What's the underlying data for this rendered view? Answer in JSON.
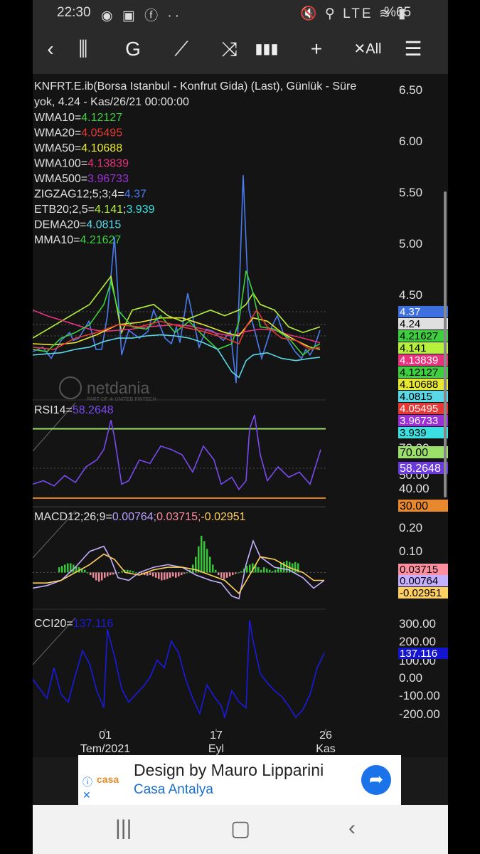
{
  "status": {
    "time": "22:30",
    "left_icons": "◉ ▣ ⓕ ··",
    "right_icons": "🔇 ⚲ LTE ≋ ▮",
    "battery": "%65"
  },
  "toolbar": [
    {
      "name": "back-icon",
      "glyph": "‹"
    },
    {
      "name": "candlestick-icon",
      "glyph": "⫼"
    },
    {
      "name": "g-label",
      "glyph": "G"
    },
    {
      "name": "trendline-icon",
      "glyph": "⟋"
    },
    {
      "name": "indicator-icon",
      "glyph": "⤨"
    },
    {
      "name": "bar-chart-icon",
      "glyph": "▮▮▮"
    },
    {
      "name": "crosshair-icon",
      "glyph": "+"
    },
    {
      "name": "clear-all-icon",
      "glyph": "✕All"
    },
    {
      "name": "menu-icon",
      "glyph": "☰"
    }
  ],
  "chart_header": {
    "line1": "KNFRT.E.ib(Borsa Istanbul - Konfrut Gida) (Last),  Günlük - Süre",
    "line2": "yok, 4.24 - Kas/26/21 00:00:00"
  },
  "chart_data": [
    {
      "type": "line",
      "title": "",
      "ylim": [
        3.75,
        6.65
      ],
      "y_ticks": [
        "6.50",
        "6.00",
        "5.50",
        "5.00",
        "4.50"
      ],
      "legend": [
        {
          "label": "WMA10=",
          "value": "4.12127",
          "color": "#3ecf3e"
        },
        {
          "label": "WMA20=",
          "value": "4.05495",
          "color": "#e53935"
        },
        {
          "label": "WMA50=",
          "value": "4.10688",
          "color": "#e8e830"
        },
        {
          "label": "WMA100=",
          "value": "4.13839",
          "color": "#e8327e"
        },
        {
          "label": "WMA500=",
          "value": "3.96733",
          "color": "#9b30d9"
        },
        {
          "label": "ZIGZAG12;5;3;4=",
          "value": "4.37",
          "color": "#4a7bf0"
        },
        {
          "label": "ETB20;2,5=",
          "value": "4.141",
          "value2": "3.939",
          "color": "#b6f03c",
          "color2": "#3ce0e0"
        },
        {
          "label": "DEMA20=",
          "value": "4.0815",
          "color": "#5ad8e8"
        },
        {
          "label": "MMA10=",
          "value": "4.21627",
          "color": "#3ecf3e"
        }
      ],
      "value_tags": [
        {
          "text": "4.37",
          "bg": "#3d6fe0",
          "fg": "#ffffff"
        },
        {
          "text": "4.24",
          "bg": "#e0e0e0",
          "fg": "#000000"
        },
        {
          "text": "4.21627",
          "bg": "#3ecf3e",
          "fg": "#000000"
        },
        {
          "text": "4.141",
          "bg": "#b6f03c",
          "fg": "#000000"
        },
        {
          "text": "4.13839",
          "bg": "#e8327e",
          "fg": "#ffffff"
        },
        {
          "text": "4.12127",
          "bg": "#3ecf3e",
          "fg": "#000000"
        },
        {
          "text": "4.10688",
          "bg": "#e8e830",
          "fg": "#000000"
        },
        {
          "text": "4.0815",
          "bg": "#5ad8e8",
          "fg": "#000000"
        },
        {
          "text": "4.05495",
          "bg": "#e53935",
          "fg": "#ffffff"
        },
        {
          "text": "3.96733",
          "bg": "#9b30d9",
          "fg": "#ffffff"
        },
        {
          "text": "3.939",
          "bg": "#3ce0e0",
          "fg": "#000000"
        }
      ],
      "series": [
        {
          "color": "#4a7bf0",
          "x": [
            0,
            14,
            26,
            40,
            52,
            57,
            65,
            79,
            89,
            97,
            105,
            115,
            125,
            135,
            150,
            162,
            170,
            186,
            195,
            202,
            207,
            218,
            234,
            244,
            254,
            268,
            278,
            286,
            296,
            304,
            312,
            322,
            336,
            344,
            352,
            362,
            369,
            378,
            384,
            390,
            396,
            404
          ],
          "values": [
            4.18,
            4.22,
            4.12,
            4.28,
            4.35,
            4.28,
            4.3,
            4.45,
            4.2,
            4.2,
            4.5,
            5.2,
            4.15,
            4.37,
            4.3,
            4.36,
            4.55,
            4.3,
            4.25,
            4.4,
            4.26,
            4.7,
            4.22,
            4.38,
            4.36,
            4.28,
            4.36,
            3.9,
            5.75,
            4.55,
            4.37,
            4.12,
            4.4,
            4.5,
            4.35,
            4.25,
            4.18,
            4.12,
            4.2,
            4.15,
            4.22,
            4.37
          ]
        },
        {
          "color": "#b6f03c",
          "x": [
            0,
            40,
            80,
            110,
            125,
            140,
            170,
            190,
            210,
            230,
            250,
            270,
            290,
            300,
            310,
            320,
            340,
            360,
            380,
            404
          ],
          "values": [
            4.3,
            4.45,
            4.6,
            4.85,
            4.35,
            4.55,
            4.6,
            4.5,
            4.45,
            4.5,
            4.55,
            4.5,
            4.55,
            4.6,
            4.7,
            4.6,
            4.55,
            4.4,
            4.35,
            4.4
          ]
        },
        {
          "color": "#e8327e",
          "x": [
            0,
            20,
            40,
            60,
            80,
            100,
            120,
            140,
            160,
            180,
            200,
            220,
            240,
            260,
            280,
            300,
            320,
            340,
            360,
            380,
            404
          ],
          "values": [
            4.55,
            4.5,
            4.46,
            4.42,
            4.38,
            4.36,
            4.37,
            4.38,
            4.4,
            4.41,
            4.42,
            4.41,
            4.38,
            4.34,
            4.32,
            4.36,
            4.38,
            4.37,
            4.33,
            4.3,
            4.26
          ]
        },
        {
          "color": "#e8e830",
          "x": [
            0,
            30,
            60,
            90,
            120,
            150,
            180,
            210,
            240,
            270,
            290,
            300,
            310,
            330,
            350,
            370,
            390,
            404
          ],
          "values": [
            4.25,
            4.24,
            4.26,
            4.33,
            4.42,
            4.44,
            4.48,
            4.48,
            4.42,
            4.35,
            4.32,
            4.4,
            4.48,
            4.45,
            4.35,
            4.28,
            4.22,
            4.2
          ]
        },
        {
          "color": "#3ecf3e",
          "x": [
            0,
            20,
            40,
            60,
            80,
            100,
            110,
            120,
            140,
            160,
            180,
            200,
            220,
            240,
            260,
            280,
            290,
            300,
            310,
            320,
            340,
            360,
            380,
            390,
            404
          ],
          "values": [
            4.2,
            4.18,
            4.3,
            4.35,
            4.42,
            4.6,
            4.8,
            4.55,
            4.4,
            4.38,
            4.5,
            4.35,
            4.45,
            4.32,
            4.2,
            4.25,
            4.45,
            4.9,
            4.7,
            4.4,
            4.38,
            4.3,
            4.15,
            4.2,
            4.25
          ]
        },
        {
          "color": "#e53935",
          "x": [
            0,
            30,
            60,
            90,
            120,
            150,
            180,
            210,
            240,
            270,
            290,
            300,
            315,
            330,
            350,
            370,
            390,
            404
          ],
          "values": [
            4.22,
            4.2,
            4.3,
            4.35,
            4.42,
            4.4,
            4.45,
            4.4,
            4.36,
            4.3,
            4.25,
            4.4,
            4.55,
            4.4,
            4.3,
            4.28,
            4.2,
            4.22
          ]
        },
        {
          "color": "#5ad8e8",
          "x": [
            0,
            20,
            40,
            60,
            80,
            100,
            120,
            140,
            160,
            180,
            200,
            220,
            240,
            260,
            280,
            290,
            300,
            310,
            330,
            350,
            370,
            390,
            404
          ],
          "values": [
            4.15,
            4.16,
            4.17,
            4.2,
            4.22,
            4.27,
            4.3,
            4.3,
            4.32,
            4.33,
            4.32,
            4.3,
            4.26,
            4.2,
            4.0,
            3.95,
            4.1,
            4.15,
            4.17,
            4.12,
            4.1,
            4.12,
            4.13
          ]
        }
      ]
    },
    {
      "type": "line",
      "legend": [
        {
          "label": "RSI14=",
          "value": "58.2648",
          "color": "#7a4af0"
        }
      ],
      "ylim": [
        25,
        85
      ],
      "y_ticks": [
        "70.00",
        "50.00",
        "40.00"
      ],
      "hlines": [
        {
          "value": 70,
          "color": "#9be06a"
        },
        {
          "value": 30,
          "color": "#e8882c"
        }
      ],
      "value_tags": [
        {
          "text": "70.00",
          "bg": "#9be06a",
          "fg": "#000000"
        },
        {
          "text": "58.2648",
          "bg": "#6a3ae0",
          "fg": "#ffffff"
        },
        {
          "text": "30.00",
          "bg": "#e8882c",
          "fg": "#000000"
        }
      ],
      "series": [
        {
          "color": "#7a4af0",
          "x": [
            0,
            15,
            30,
            45,
            60,
            75,
            90,
            100,
            110,
            115,
            125,
            135,
            150,
            165,
            180,
            195,
            210,
            225,
            240,
            255,
            265,
            280,
            290,
            300,
            305,
            312,
            320,
            330,
            345,
            360,
            375,
            390,
            405
          ],
          "values": [
            38,
            40,
            37,
            43,
            39,
            48,
            52,
            58,
            75,
            65,
            38,
            40,
            52,
            50,
            60,
            58,
            55,
            45,
            60,
            52,
            38,
            42,
            35,
            40,
            70,
            78,
            55,
            40,
            48,
            42,
            45,
            38,
            58
          ]
        }
      ]
    },
    {
      "type": "bar",
      "legend": [
        {
          "label": "MACD12;26;9=",
          "value": "0.00764;0.03715;-0.02951",
          "color": "#c9b6ff",
          "colors": [
            "#b9a0ff",
            "#ff8fa0",
            "#ffd060"
          ]
        }
      ],
      "ylim": [
        -0.14,
        0.24
      ],
      "y_ticks": [
        "0.20",
        "0.10"
      ],
      "value_tags": [
        {
          "text": "0.03715",
          "bg": "#ff8fa0",
          "fg": "#000000"
        },
        {
          "text": "0.00764",
          "bg": "#c4b0ff",
          "fg": "#000000"
        },
        {
          "text": "-0.02951",
          "bg": "#ffd060",
          "fg": "#000000"
        }
      ],
      "histogram": {
        "x_start": 36,
        "x_step": 4,
        "values": [
          0.02,
          0.025,
          0.03,
          0.035,
          0.035,
          0.03,
          0.025,
          0.02,
          0.015,
          0.01,
          0.0,
          -0.01,
          -0.02,
          -0.03,
          -0.035,
          -0.03,
          -0.02,
          -0.015,
          -0.01,
          -0.008,
          -0.005,
          0.0,
          0.005,
          0.01,
          0.01,
          0.008,
          0.005,
          0.0,
          -0.005,
          -0.008,
          -0.01,
          -0.012,
          -0.01,
          -0.015,
          -0.02,
          -0.025,
          -0.03,
          -0.028,
          -0.025,
          -0.02,
          -0.015,
          -0.02,
          -0.015,
          -0.01,
          -0.005,
          0.0,
          0.01,
          0.03,
          0.06,
          0.1,
          0.14,
          0.12,
          0.09,
          0.06,
          0.03,
          0.01,
          -0.01,
          -0.02,
          -0.025,
          -0.02,
          -0.015,
          -0.01,
          -0.005,
          0.0,
          0.005,
          0.015,
          0.025,
          0.03,
          0.035,
          0.03,
          0.02,
          0.01,
          0.02,
          0.015,
          0.01,
          0.005,
          0.01,
          0.02,
          0.035,
          0.04,
          0.045,
          0.04,
          0.035,
          0.04,
          0.035
        ]
      },
      "series": [
        {
          "color": "#c4b0ff",
          "x": [
            0,
            20,
            40,
            60,
            80,
            100,
            110,
            120,
            135,
            150,
            170,
            190,
            210,
            230,
            250,
            265,
            280,
            290,
            300,
            310,
            320,
            340,
            360,
            380,
            395,
            410
          ],
          "values": [
            -0.06,
            -0.05,
            -0.03,
            0.02,
            0.08,
            0.1,
            0.05,
            -0.02,
            -0.03,
            0.0,
            0.02,
            0.03,
            0.02,
            -0.01,
            -0.03,
            -0.04,
            -0.09,
            -0.1,
            0.03,
            0.12,
            0.06,
            0.02,
            0.01,
            -0.02,
            -0.06,
            -0.03
          ]
        },
        {
          "color": "#ffd060",
          "x": [
            0,
            20,
            40,
            60,
            80,
            100,
            115,
            130,
            150,
            170,
            190,
            210,
            230,
            250,
            270,
            290,
            305,
            320,
            340,
            360,
            380,
            395,
            410
          ],
          "values": [
            -0.04,
            -0.04,
            -0.03,
            0.0,
            0.03,
            0.07,
            0.05,
            0.0,
            -0.01,
            0.01,
            0.02,
            0.02,
            0.01,
            -0.01,
            -0.03,
            -0.08,
            -0.01,
            0.06,
            0.05,
            0.02,
            0.0,
            -0.03,
            -0.03
          ]
        }
      ]
    },
    {
      "type": "line",
      "legend": [
        {
          "label": "CCI20=",
          "value": "137.116",
          "color": "#1a1ae0"
        }
      ],
      "ylim": [
        -260,
        330
      ],
      "y_ticks": [
        "300.00",
        "200.00",
        "100.00",
        "0.00",
        "-100.00",
        "-200.00"
      ],
      "value_tags": [
        {
          "text": "137.116",
          "bg": "#1515d0",
          "fg": "#ffffff"
        }
      ],
      "series": [
        {
          "color": "#1a1ae0",
          "x": [
            0,
            10,
            20,
            30,
            40,
            50,
            60,
            70,
            80,
            90,
            100,
            105,
            115,
            125,
            135,
            145,
            155,
            165,
            175,
            185,
            195,
            205,
            215,
            225,
            235,
            245,
            255,
            265,
            270,
            280,
            290,
            300,
            305,
            310,
            320,
            330,
            340,
            350,
            360,
            370,
            380,
            390,
            400,
            410
          ],
          "values": [
            0,
            -50,
            -100,
            60,
            -80,
            -120,
            20,
            150,
            80,
            -60,
            -150,
            260,
            120,
            -50,
            -120,
            -80,
            -40,
            10,
            100,
            60,
            200,
            140,
            0,
            -100,
            -180,
            -30,
            -90,
            -140,
            -200,
            -60,
            -120,
            -150,
            310,
            200,
            30,
            -20,
            -60,
            -90,
            -140,
            -200,
            -160,
            -80,
            60,
            137
          ]
        }
      ]
    }
  ],
  "watermark": {
    "brand": "netdania",
    "sub": "PART OF ⊕ UNITED FINTECH"
  },
  "x_ticks": [
    {
      "day": "01",
      "month": "Tem/2021"
    },
    {
      "day": "17",
      "month": "Eyl"
    },
    {
      "day": "26",
      "month": "Kas"
    }
  ],
  "ad": {
    "brand": "casa",
    "title": "Design by Mauro Lipparini",
    "subtitle": "Casa Antalya",
    "info_icon": "ⓘ",
    "close_icon": "✕",
    "go_icon": "➦"
  },
  "nav": {
    "recent": "|||",
    "home": "▢",
    "back": "‹"
  }
}
